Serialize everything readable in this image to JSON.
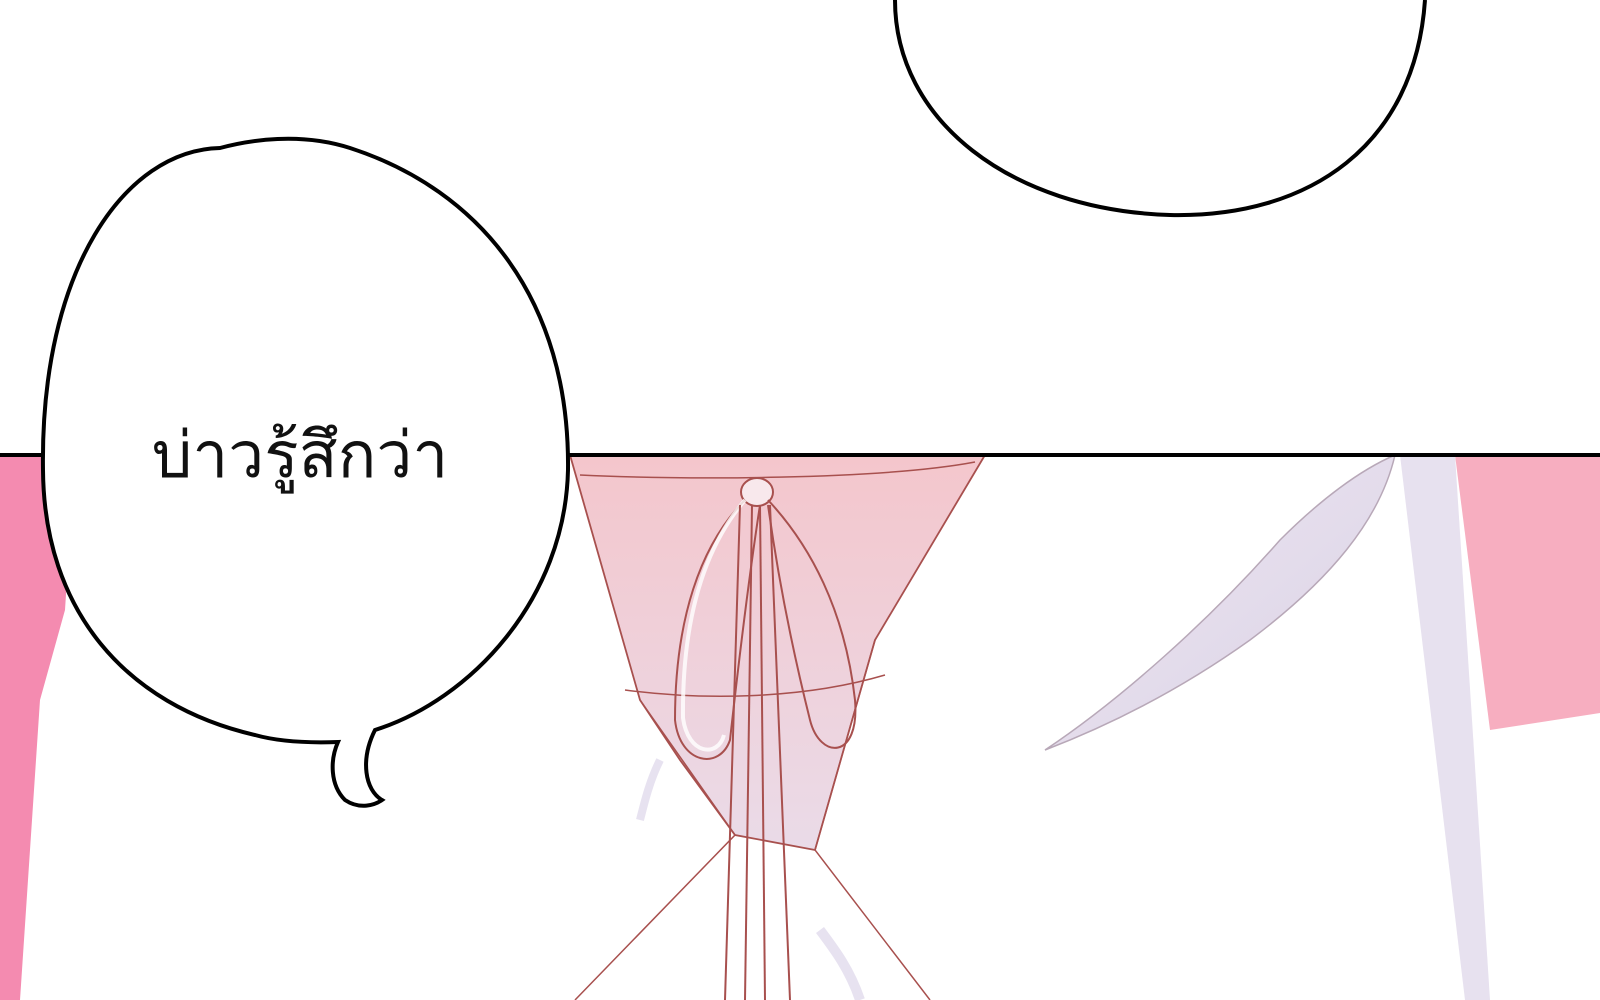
{
  "speech_bubble": {
    "text": "บ่าวรู้สึกว่า"
  },
  "colors": {
    "background": "#ffffff",
    "outline": "#000000",
    "pink_left": "#f48bb0",
    "pink_right": "#f7aec0",
    "ribbon_pink": "#f3c9d0",
    "shadow_lilac": "#ddd6ea",
    "line_brown": "#a8504e"
  }
}
